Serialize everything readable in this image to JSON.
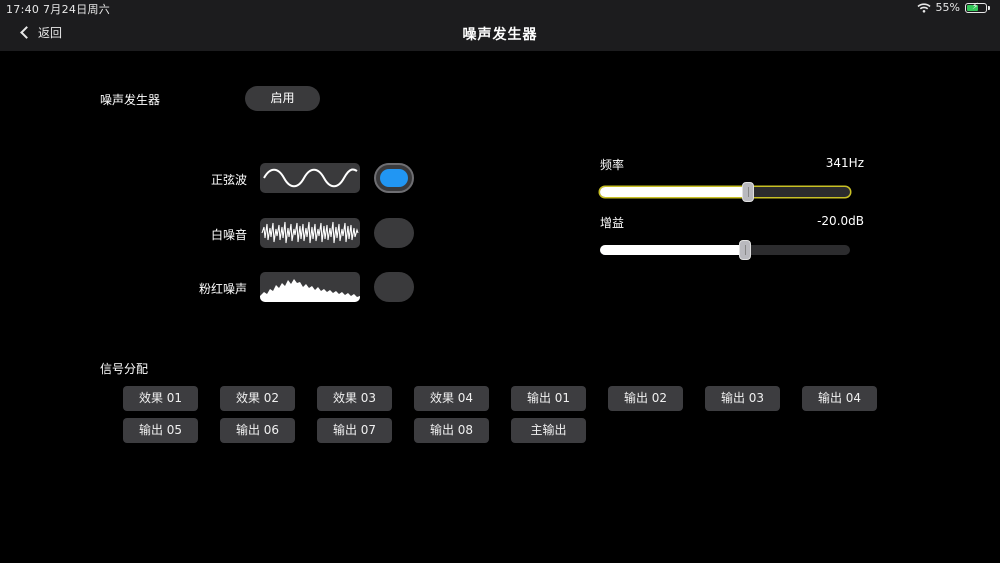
{
  "status_bar": {
    "time_date": "17:40  7月24日周六",
    "battery": "55%"
  },
  "nav": {
    "back_label": "返回",
    "title": "噪声发生器"
  },
  "generator": {
    "label": "噪声发生器",
    "enable_label": "启用"
  },
  "waveforms": [
    {
      "label": "正弦波",
      "selected": true
    },
    {
      "label": "白噪音",
      "selected": false
    },
    {
      "label": "粉红噪声",
      "selected": false
    }
  ],
  "frequency": {
    "label": "频率",
    "value": "341Hz",
    "level": 0.59
  },
  "gain": {
    "label": "增益",
    "value": "-20.0dB",
    "level": 0.58
  },
  "routing": {
    "label": "信号分配",
    "buttons": [
      "效果 01",
      "效果 02",
      "效果 03",
      "效果 04",
      "输出 01",
      "输出 02",
      "输出 03",
      "输出 04",
      "输出 05",
      "输出 06",
      "输出 07",
      "输出 08",
      "主输出"
    ]
  },
  "colors": {
    "accent_blue": "#2196f3",
    "focus_outline": "#c9c126",
    "battery_green": "#34c759"
  }
}
